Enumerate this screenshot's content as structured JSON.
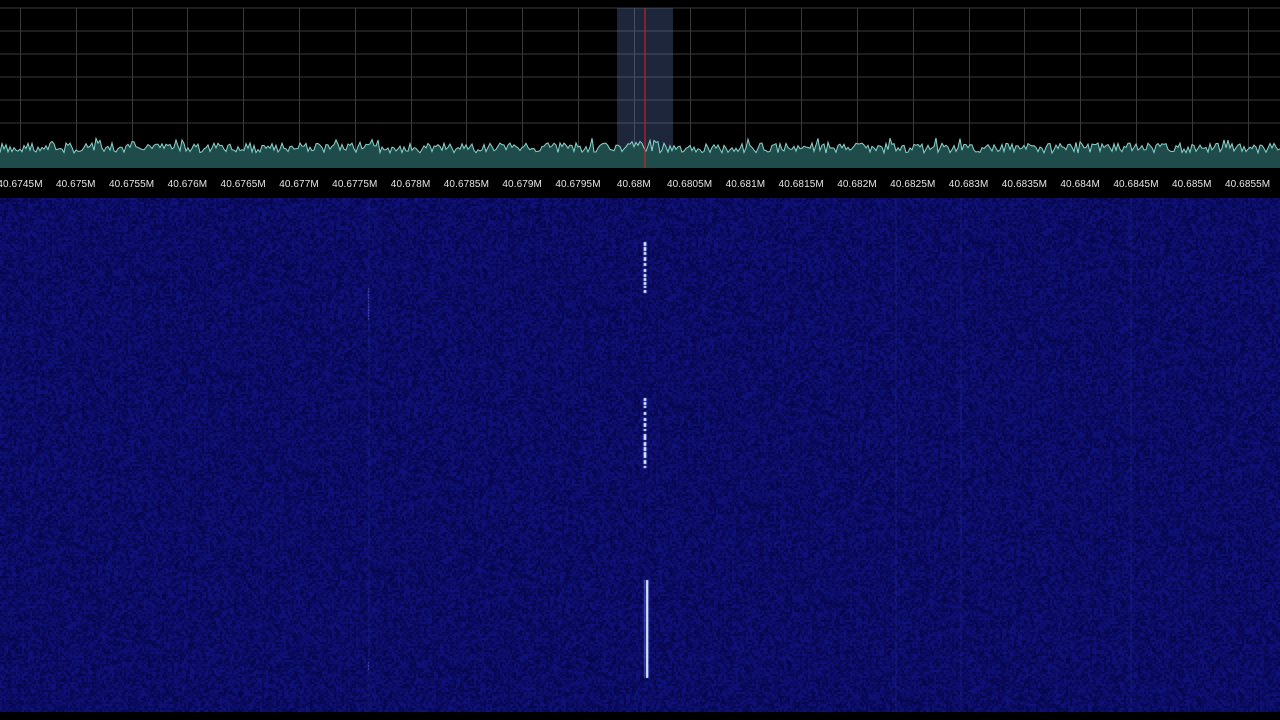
{
  "spectrum": {
    "trace_color": "#8ad6cf",
    "fill_color": "#1f4c4a",
    "grid_color": "#3a3a3a",
    "background": "#000000",
    "tuning_marker_color": "#e02020",
    "passband_color": "#6a8ad8"
  },
  "frequency_axis": {
    "labels": [
      "40.6745M",
      "40.675M",
      "40.6755M",
      "40.676M",
      "40.6765M",
      "40.677M",
      "40.6775M",
      "40.678M",
      "40.6785M",
      "40.679M",
      "40.6795M",
      "40.68M",
      "40.6805M",
      "40.681M",
      "40.6815M",
      "40.682M",
      "40.6825M",
      "40.683M",
      "40.6835M",
      "40.684M",
      "40.6845M",
      "40.685M",
      "40.6855M"
    ],
    "label_color": "#e6e6e6"
  },
  "waterfall": {
    "background_color": "#0a0a55",
    "signal_color": "#e8f0ff"
  }
}
